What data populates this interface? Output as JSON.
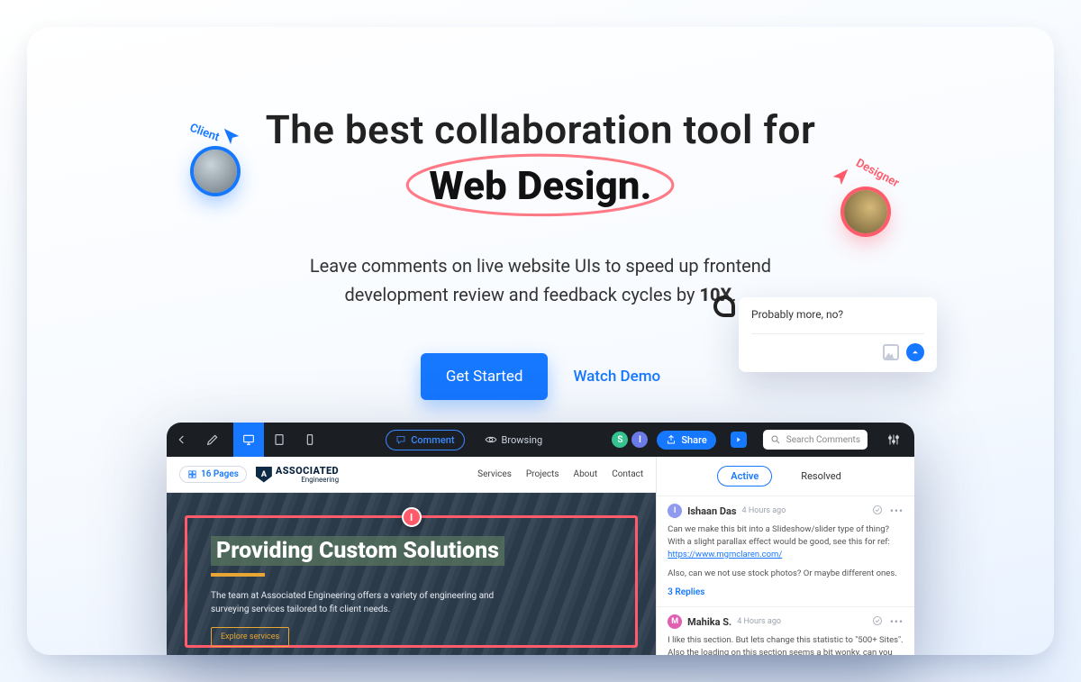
{
  "hero": {
    "line1": "The best collaboration tool for",
    "highlight": "Web Design.",
    "sub_line1": "Leave comments on live website UIs to speed up frontend",
    "sub_line2_a": "development review and feedback cycles by ",
    "sub_line2_b": "10X",
    "sub_line2_c": ".",
    "cta_primary": "Get Started",
    "cta_secondary": "Watch Demo"
  },
  "cursors": {
    "client_label": "Client",
    "designer_label": "Designer"
  },
  "float_input": {
    "text": "Probably more, no?"
  },
  "app": {
    "topbar": {
      "comment": "Comment",
      "browsing": "Browsing",
      "share": "Share",
      "search_placeholder": "Search Comments",
      "avatar_s": "S",
      "avatar_i": "I"
    },
    "site": {
      "pages_label": "16 Pages",
      "logo_top": "ASSOCIATED",
      "logo_bottom": "Engineering",
      "nav": [
        "Services",
        "Projects",
        "About",
        "Contact"
      ],
      "hero_title": "Providing Custom Solutions",
      "hero_body": "The team at Associated Engineering offers a variety of engineering and surveying services tailored to fit client needs.",
      "explore": "Explore services",
      "sel_badge": "I"
    },
    "panel": {
      "tab_active": "Active",
      "tab_resolved": "Resolved",
      "threads": [
        {
          "avatar": "I",
          "avatar_class": "i",
          "name": "Ishaan Das",
          "time": "4 Hours ago",
          "body_a": "Can we make this bit into a Slideshow/slider type of thing? With a slight parallax effect would be good, see this for ref: ",
          "body_link": "https://www.mgmclaren.com/",
          "body_b": "Also, can we not use stock photos? Or maybe different ones.",
          "replies": "3 Replies"
        },
        {
          "avatar": "M",
          "avatar_class": "m",
          "name": "Mahika S.",
          "time": "4 Hours ago",
          "body_a": "I like this section. But lets change this statistic to \"500+ Sites\". Also the loading on this section seems a bit wonky, can you look",
          "body_link": "",
          "body_b": "",
          "replies": ""
        }
      ]
    }
  }
}
